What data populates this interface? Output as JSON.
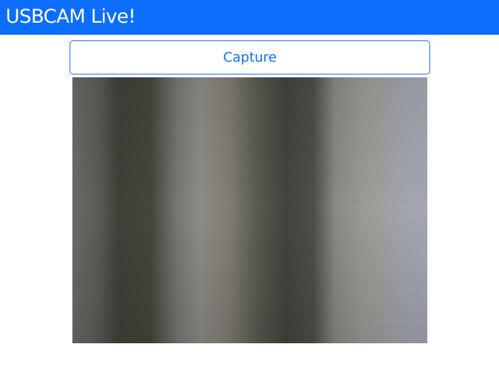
{
  "header": {
    "title": "USBCAM Live!",
    "color": "#0d6efd"
  },
  "controls": {
    "capture_label": "Capture"
  },
  "feed": {
    "description_icon": "camera-feed-image"
  }
}
